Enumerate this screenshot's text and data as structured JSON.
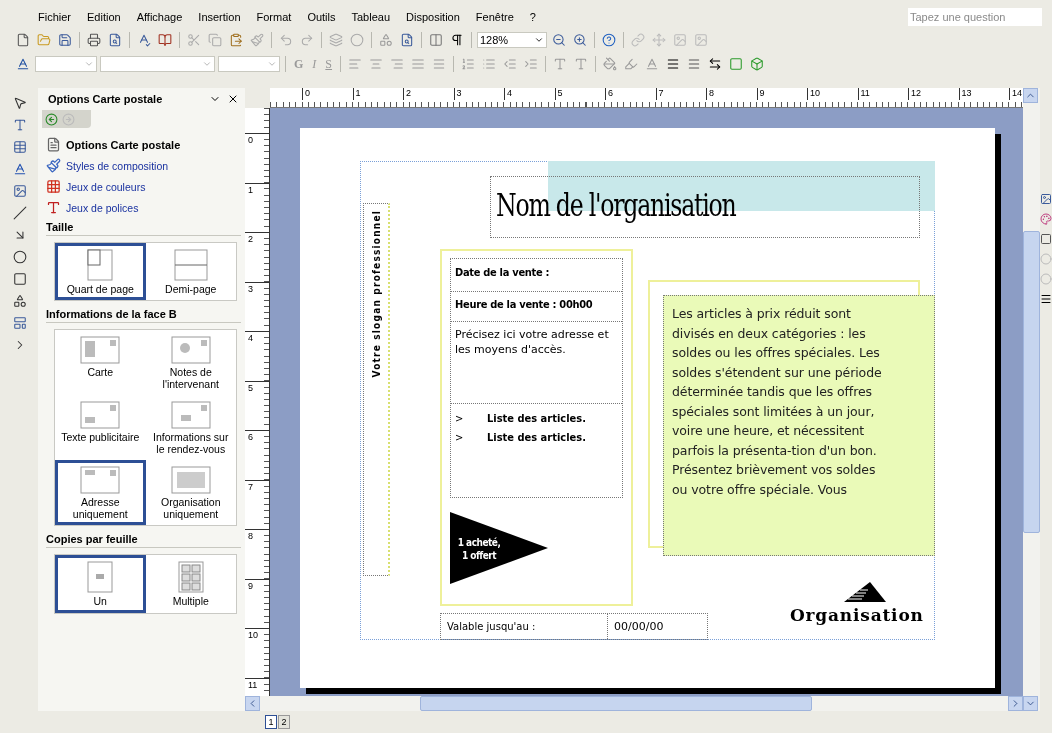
{
  "menu": [
    "Fichier",
    "Edition",
    "Affichage",
    "Insertion",
    "Format",
    "Outils",
    "Tableau",
    "Disposition",
    "Fenêtre",
    "?"
  ],
  "question_box": {
    "placeholder": "Tapez une question"
  },
  "toolbar": {
    "zoom": "128%",
    "format_buttons": [
      "G",
      "I",
      "S"
    ]
  },
  "task_pane": {
    "title": "Options Carte postale",
    "links": [
      {
        "label": "Options Carte postale",
        "current": true,
        "kind": "options"
      },
      {
        "label": "Styles de composition",
        "current": false,
        "kind": "styles"
      },
      {
        "label": "Jeux de couleurs",
        "current": false,
        "kind": "colors"
      },
      {
        "label": "Jeux de polices",
        "current": false,
        "kind": "fonts"
      }
    ],
    "sections": [
      {
        "title": "Taille",
        "options": [
          {
            "label": "Quart de page",
            "kind": "quarter",
            "selected": true
          },
          {
            "label": "Demi-page",
            "kind": "half",
            "selected": false
          }
        ]
      },
      {
        "title": "Informations de la face B",
        "options": [
          {
            "label": "Carte",
            "kind": "card",
            "selected": false
          },
          {
            "label": "Notes de l'intervenant",
            "kind": "notes",
            "selected": false
          },
          {
            "label": "Texte publicitaire",
            "kind": "text",
            "selected": false
          },
          {
            "label": "Informations sur le rendez-vous",
            "kind": "appointment",
            "selected": false
          },
          {
            "label": "Adresse uniquement",
            "kind": "address",
            "selected": true
          },
          {
            "label": "Organisation uniquement",
            "kind": "org",
            "selected": false
          }
        ]
      },
      {
        "title": "Copies par feuille",
        "options": [
          {
            "label": "Un",
            "kind": "one",
            "selected": true
          },
          {
            "label": "Multiple",
            "kind": "multiple",
            "selected": false
          }
        ]
      }
    ]
  },
  "ruler": {
    "horizontal": [
      "0",
      "1",
      "2",
      "3",
      "4",
      "5",
      "6",
      "7",
      "8",
      "9",
      "10",
      "11",
      "12",
      "13",
      "14"
    ],
    "vertical": [
      "0",
      "1",
      "2",
      "3",
      "4",
      "5",
      "6",
      "7",
      "8",
      "9",
      "10",
      "11"
    ]
  },
  "publication": {
    "heading": "Nom de l'organisation",
    "slogan": "Votre slogan professionnel",
    "sale_date": "Date de la vente :",
    "sale_time": "Heure de la vente : 00h00",
    "address": "Précisez ici votre adresse et les moyens d'accès.",
    "items": [
      {
        "bullet": ">",
        "text": "Liste des articles."
      },
      {
        "bullet": ">",
        "text": "Liste des articles."
      }
    ],
    "pennant": "1 acheté, 1 offert",
    "body": [
      "Les articles à prix réduit sont divisés en deux catégories : les soldes ou les offres spéciales. Les soldes s'étendent sur une période déterminée tandis que les offres spéciales sont limitées à un jour, voire une heure, et nécessitent parfois la présenta-tion d'un bon.",
      "Présentez brièvement vos soldes ou votre offre spéciale. Vous"
    ],
    "valid_label": "Valable jusqu'au :",
    "valid_date": "00/00/00",
    "logo": "Organisation"
  },
  "page_tabs": [
    {
      "label": "1",
      "selected": true
    },
    {
      "label": "2",
      "selected": false
    }
  ]
}
